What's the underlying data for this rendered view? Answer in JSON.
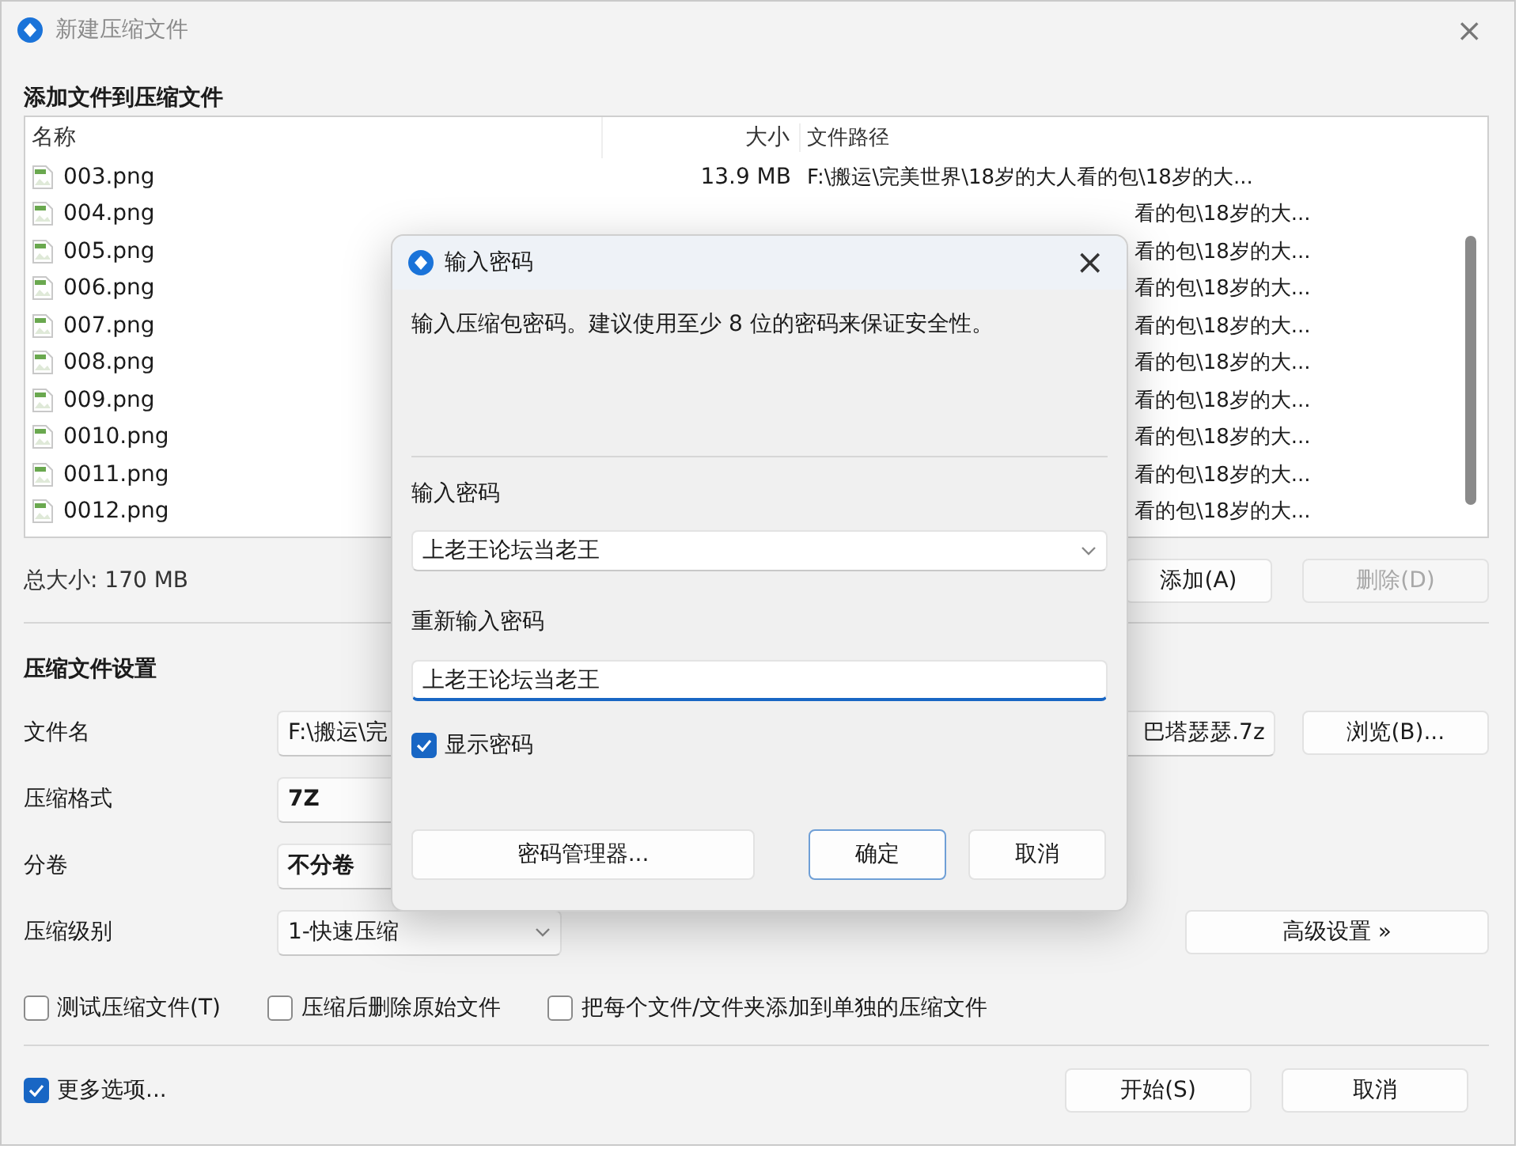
{
  "window": {
    "title": "新建压缩文件",
    "close": "×"
  },
  "files": {
    "heading": "添加文件到压缩文件",
    "columns": [
      "名称",
      "大小",
      "文件路径"
    ],
    "rows": [
      {
        "name": "003.png",
        "size": "13.9 MB",
        "path": "F:\\搬运\\完美世界\\18岁的大人看的包\\18岁的大..."
      },
      {
        "name": "004.png",
        "path": "看的包\\18岁的大..."
      },
      {
        "name": "005.png",
        "path": "看的包\\18岁的大..."
      },
      {
        "name": "006.png",
        "path": "看的包\\18岁的大..."
      },
      {
        "name": "007.png",
        "path": "看的包\\18岁的大..."
      },
      {
        "name": "008.png",
        "path": "看的包\\18岁的大..."
      },
      {
        "name": "009.png",
        "path": "看的包\\18岁的大..."
      },
      {
        "name": "0010.png",
        "path": "看的包\\18岁的大..."
      },
      {
        "name": "0011.png",
        "path": "看的包\\18岁的大..."
      },
      {
        "name": "0012.png",
        "path": "看的包\\18岁的大..."
      }
    ],
    "total": "总大小: 170 MB",
    "buttons": [
      {
        "label": "添加(A)",
        "disabled": false
      },
      {
        "label": "删除(D)",
        "disabled": true
      }
    ]
  },
  "settings": {
    "heading": "压缩文件设置",
    "fields": [
      {
        "kind": "path",
        "label": "文件名",
        "value_start": "F:\\搬运\\完",
        "value_end": "巴塔瑟瑟.7z",
        "button": "浏览(B)..."
      },
      {
        "kind": "combo",
        "label": "压缩格式",
        "value": "7Z"
      },
      {
        "kind": "combo",
        "label": "分卷",
        "value": "不分卷"
      },
      {
        "kind": "dropdown",
        "label": "压缩级别",
        "value": "1-快速压缩",
        "button": "高级设置 »"
      }
    ],
    "options": [
      {
        "label": "测试压缩文件(T)",
        "checked": false
      },
      {
        "label": "压缩后删除原始文件",
        "checked": false
      },
      {
        "label": "把每个文件/文件夹添加到单独的压缩文件",
        "checked": false
      }
    ]
  },
  "footer": {
    "more_options": {
      "label": "更多选项...",
      "checked": true
    },
    "buttons": [
      {
        "label": "开始(S)"
      },
      {
        "label": "取消"
      }
    ]
  },
  "dialog": {
    "title": "输入密码",
    "close": "×",
    "message": "输入压缩包密码。建议使用至少 8 位的密码来保证安全性。",
    "password_label": "输入密码",
    "password": "上老王论坛当老王",
    "confirm_label": "重新输入密码",
    "confirm": "上老王论坛当老王",
    "show_password": {
      "label": "显示密码",
      "checked": true
    },
    "buttons": [
      {
        "label": "密码管理器...",
        "default": false
      },
      {
        "label": "确定",
        "default": true
      },
      {
        "label": "取消",
        "default": false
      }
    ]
  }
}
